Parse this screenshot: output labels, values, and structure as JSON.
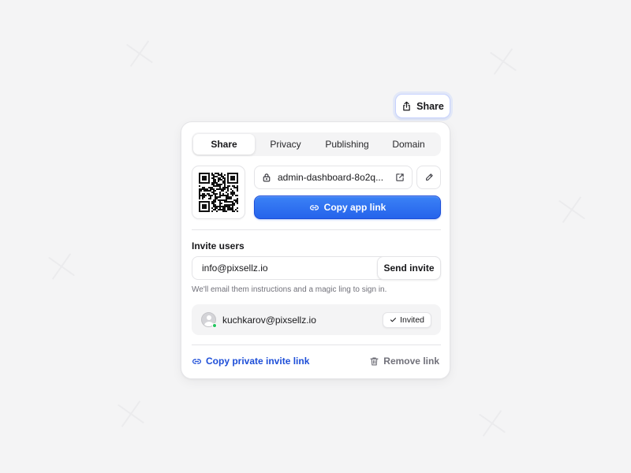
{
  "trigger": {
    "label": "Share",
    "icon": "share-icon"
  },
  "tabs": [
    {
      "label": "Share",
      "active": true
    },
    {
      "label": "Privacy",
      "active": false
    },
    {
      "label": "Publishing",
      "active": false
    },
    {
      "label": "Domain",
      "active": false
    }
  ],
  "link": {
    "url": "admin-dashboard-8o2q...",
    "copy_label": "Copy app link"
  },
  "invite": {
    "title": "Invite users",
    "email_value": "info@pixsellz.io",
    "send_label": "Send invite",
    "helper": "We'll email them instructions and a magic ling to sign in."
  },
  "users": [
    {
      "email": "kuchkarov@pixsellz.io",
      "status": "Invited"
    }
  ],
  "footer": {
    "copy_private_label": "Copy private invite link",
    "remove_label": "Remove link"
  },
  "colors": {
    "accent": "#2563eb",
    "link": "#1d4ed8",
    "online": "#22c55e",
    "background": "#f4f4f5"
  }
}
